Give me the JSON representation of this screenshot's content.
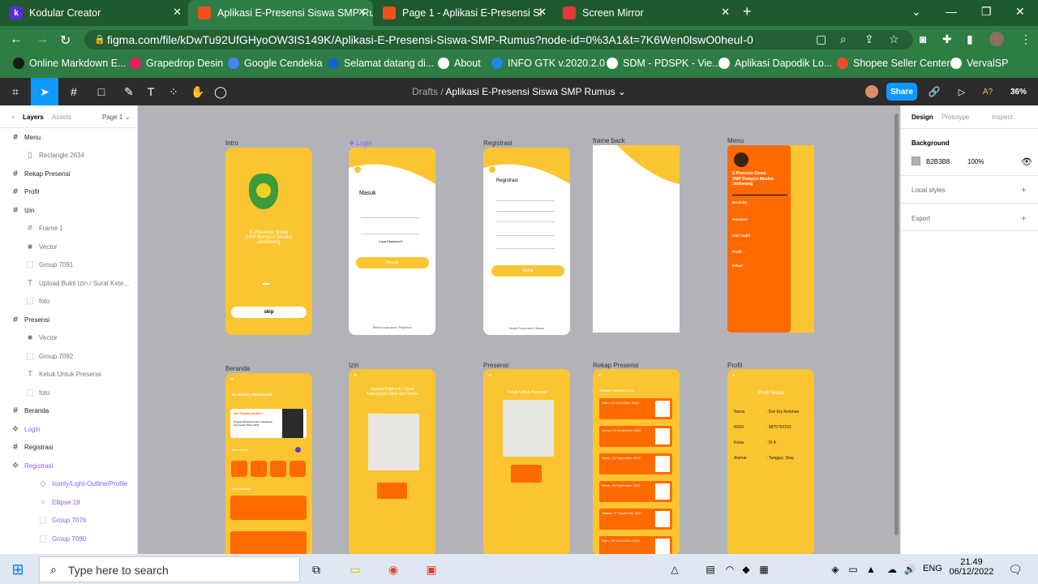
{
  "tabs": [
    {
      "label": "Kodular Creator",
      "icon": "kodular-icon",
      "color": "#5a2bd7",
      "active": false
    },
    {
      "label": "Aplikasi E-Presensi Siswa SMP Ru",
      "icon": "figma-icon",
      "color": "#f24e1e",
      "active": true
    },
    {
      "label": "Page 1 - Aplikasi E-Presensi Si",
      "icon": "figma-icon",
      "color": "#f24e1e",
      "active": false
    },
    {
      "label": "Screen Mirror",
      "icon": "screen-mirror-icon",
      "color": "#e53935",
      "active": false
    }
  ],
  "address": {
    "url": "figma.com/file/kDwTu92UfGHyoOW3IS149K/Aplikasi-E-Presensi-Siswa-SMP-Rumus?node-id=0%3A1&t=7K6Wen0lswO0heuI-0"
  },
  "bookmarks": [
    {
      "label": "Online Markdown E...",
      "color": "#1a1a1a"
    },
    {
      "label": "Grapedrop Desin",
      "color": "#e91e63"
    },
    {
      "label": "Google Cendekia",
      "color": "#4285f4"
    },
    {
      "label": "Selamat datang di...",
      "color": "#1565c0"
    },
    {
      "label": "About",
      "color": "#ffffff"
    },
    {
      "label": "INFO GTK v.2020.2.0",
      "color": "#1e88e5"
    },
    {
      "label": "SDM - PDSPK - Vie...",
      "color": "#ffffff"
    },
    {
      "label": "Aplikasi Dapodik Lo...",
      "color": "#ffffff"
    },
    {
      "label": "Shopee Seller Center",
      "color": "#ee4d2d"
    },
    {
      "label": "VervalSP",
      "color": "#ffffff"
    }
  ],
  "figma": {
    "breadcrumb_root": "Drafts",
    "breadcrumb_sep": "/",
    "file_name": "Aplikasi E-Presensi Siswa SMP Rumus",
    "share_label": "Share",
    "zoom": "36%"
  },
  "layers_panel": {
    "tab_layers": "Layers",
    "tab_assets": "Assets",
    "page": "Page 1",
    "items": [
      {
        "label": "Menu",
        "icon": "#",
        "type": "frame"
      },
      {
        "label": "Rectangle 2634",
        "icon": "▯",
        "type": "sub"
      },
      {
        "label": "Rekap Presensi",
        "icon": "#",
        "type": "frame"
      },
      {
        "label": "Profil",
        "icon": "#",
        "type": "frame"
      },
      {
        "label": "Izin",
        "icon": "#",
        "type": "frame"
      },
      {
        "label": "Frame 1",
        "icon": "#",
        "type": "sub"
      },
      {
        "label": "Vector",
        "icon": "■",
        "type": "sub"
      },
      {
        "label": "Group 7091",
        "icon": "⬚",
        "type": "sub"
      },
      {
        "label": "Upload Bukti Izin / Surat Kete...",
        "icon": "T",
        "type": "sub"
      },
      {
        "label": "foto",
        "icon": "⬚",
        "type": "sub"
      },
      {
        "label": "Presensi",
        "icon": "#",
        "type": "frame"
      },
      {
        "label": "Vector",
        "icon": "■",
        "type": "sub"
      },
      {
        "label": "Group 7092",
        "icon": "⬚",
        "type": "sub"
      },
      {
        "label": "Ketuk Untuk Presensi",
        "icon": "T",
        "type": "sub"
      },
      {
        "label": "foto",
        "icon": "⬚",
        "type": "sub"
      },
      {
        "label": "Beranda",
        "icon": "#",
        "type": "frame"
      },
      {
        "label": "Login",
        "icon": "❖",
        "type": "purple"
      },
      {
        "label": "Registrasi",
        "icon": "#",
        "type": "frame"
      },
      {
        "label": "Registrasi",
        "icon": "❖",
        "type": "purple"
      },
      {
        "label": "Iconly/Light-Outline/Profile",
        "icon": "◇",
        "type": "purplesub"
      },
      {
        "label": "Ellipse 19",
        "icon": "○",
        "type": "purplesub"
      },
      {
        "label": "Group 7076",
        "icon": "⬚",
        "type": "purplesub"
      },
      {
        "label": "Group 7080",
        "icon": "⬚",
        "type": "purplesub"
      }
    ]
  },
  "design_panel": {
    "tab_design": "Design",
    "tab_prototype": "Prototype",
    "tab_inspect": "Inspect",
    "background_label": "Background",
    "bg_hex": "B2B3B8",
    "bg_opacity": "100%",
    "local_styles": "Local styles",
    "export": "Export"
  },
  "canvas": {
    "frames": [
      {
        "label": "Intro"
      },
      {
        "label": "Login"
      },
      {
        "label": "Registrasi"
      },
      {
        "label": "frame back"
      },
      {
        "label": "Menu"
      },
      {
        "label": "Beranda"
      },
      {
        "label": "Izin"
      },
      {
        "label": "Presensi"
      },
      {
        "label": "Rekap Presensi"
      },
      {
        "label": "Profil"
      }
    ],
    "intro": {
      "title": "E-Presensi Siswa\nSMP Rumpun Muslim\nJatibarang",
      "skip": "skip"
    },
    "login": {
      "title": "Masuk",
      "forgot": "Lupa Password?",
      "button": "Masuk",
      "footer": "Belum punya akun? Registrasi"
    },
    "registrasi": {
      "title": "Registrasi",
      "button": "Daftar",
      "footer": "Sudah Punya akun? Masuk"
    },
    "menu": {
      "title": "E-Presensi Siswa\nSMP Rumpun Muslim\nJatibarang",
      "items": [
        "Beranda",
        "Presensi",
        "Izin / Sakit",
        "Profil",
        "keluar"
      ]
    },
    "beranda": {
      "greeting": "Hi, Dwi Ery Rohmanudi",
      "info_title": "Info Rumpun Muslim !",
      "info_body": "Program Beasiswa bagi mahasiswa berprestasi Tahun 2023",
      "menu_label": "Menu Utama",
      "recent_label": "Pemberitahuan"
    },
    "izin": {
      "text": "Upload Bukti Izin / Surat Keterangan Sakit dari Dokter"
    },
    "presensi": {
      "text": "Ketuk Untuk Presensi"
    },
    "rekap": {
      "title": "Rekap Presensi Anda",
      "rows": [
        "Rabu, 21 Desember 2022",
        "Jumat, 23 September 2022",
        "Sabtu, 24 September 2022",
        "Senin, 26 September 2022",
        "Selasa, 27 September 2022",
        "Rabu, 28 September 2022"
      ]
    },
    "profil": {
      "title": "Profil Siswa",
      "rows": [
        {
          "k": "Nama",
          "v": ": Dwi Ery Rohman"
        },
        {
          "k": "NISN",
          "v": ": 9875750153"
        },
        {
          "k": "Kelas",
          "v": ": IX A"
        },
        {
          "k": "Alamat",
          "v": ": Tunggur, Slog"
        }
      ]
    }
  },
  "taskbar": {
    "search_placeholder": "Type here to search",
    "lang": "ENG",
    "time": "21.49",
    "date": "06/12/2022"
  }
}
